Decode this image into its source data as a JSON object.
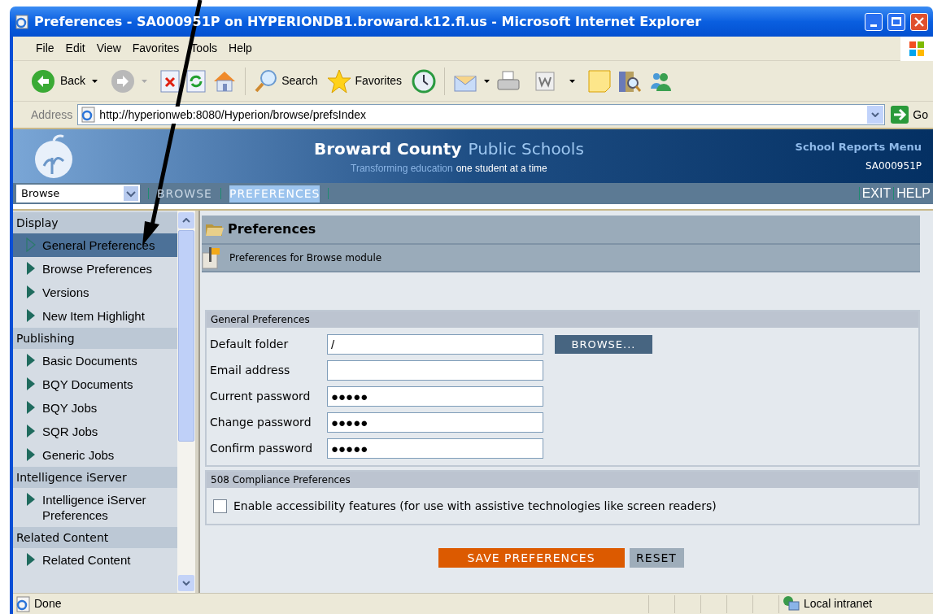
{
  "window": {
    "title": "Preferences - SA000951P on HYPERIONDB1.broward.k12.fl.us - Microsoft Internet Explorer"
  },
  "menu": [
    "File",
    "Edit",
    "View",
    "Favorites",
    "Tools",
    "Help"
  ],
  "toolbar": {
    "back": "Back",
    "search": "Search",
    "favorites": "Favorites"
  },
  "address": {
    "label": "Address",
    "url": "http://hyperionweb:8080/Hyperion/browse/prefsIndex",
    "go": "Go"
  },
  "banner": {
    "title_bold": "Broward County",
    "title_light": "Public Schools",
    "tagline_light": "Transforming education",
    "tagline_bold": "one student at a time",
    "menu_title": "School Reports Menu",
    "user": "SA000951P"
  },
  "nav": {
    "module_select": "Browse",
    "links": [
      {
        "label": "BROWSE",
        "selected": false
      },
      {
        "label": "PREFERENCES",
        "selected": true
      }
    ],
    "right_links": [
      "EXIT",
      "HELP"
    ]
  },
  "sidebar": [
    {
      "label": "Display",
      "items": [
        {
          "label": "General Preferences",
          "selected": true
        },
        {
          "label": "Browse Preferences",
          "selected": false
        },
        {
          "label": "Versions",
          "selected": false
        },
        {
          "label": "New Item Highlight",
          "selected": false
        }
      ]
    },
    {
      "label": "Publishing",
      "items": [
        {
          "label": "Basic Documents",
          "selected": false
        },
        {
          "label": "BQY Documents",
          "selected": false
        },
        {
          "label": "BQY Jobs",
          "selected": false
        },
        {
          "label": "SQR Jobs",
          "selected": false
        },
        {
          "label": "Generic Jobs",
          "selected": false
        }
      ]
    },
    {
      "label": "Intelligence iServer",
      "items": [
        {
          "label": "Intelligence iServer Preferences",
          "selected": false
        }
      ]
    },
    {
      "label": "Related Content",
      "items": [
        {
          "label": "Related Content",
          "selected": false
        }
      ]
    }
  ],
  "page": {
    "title": "Preferences",
    "subtitle": "Preferences for Browse module"
  },
  "general": {
    "title": "General Preferences",
    "browse_button": "BROWSE...",
    "fields": [
      {
        "label": "Default folder",
        "value": "/"
      },
      {
        "label": "Email address"
      },
      {
        "label": "Current password",
        "value": "●●●●●"
      },
      {
        "label": "Change password",
        "value": "●●●●●"
      },
      {
        "label": "Confirm password",
        "value": "●●●●●"
      }
    ]
  },
  "compliance": {
    "title": "508 Compliance Preferences",
    "checkbox": {
      "label": "Enable accessibility features (for use with assistive technologies like screen readers)",
      "checked": false
    }
  },
  "actions": [
    {
      "label": "SAVE PREFERENCES",
      "kind": "primary"
    },
    {
      "label": "RESET",
      "kind": "secondary"
    }
  ],
  "status_bar": {
    "text": "Done",
    "zone": "Local intranet"
  }
}
